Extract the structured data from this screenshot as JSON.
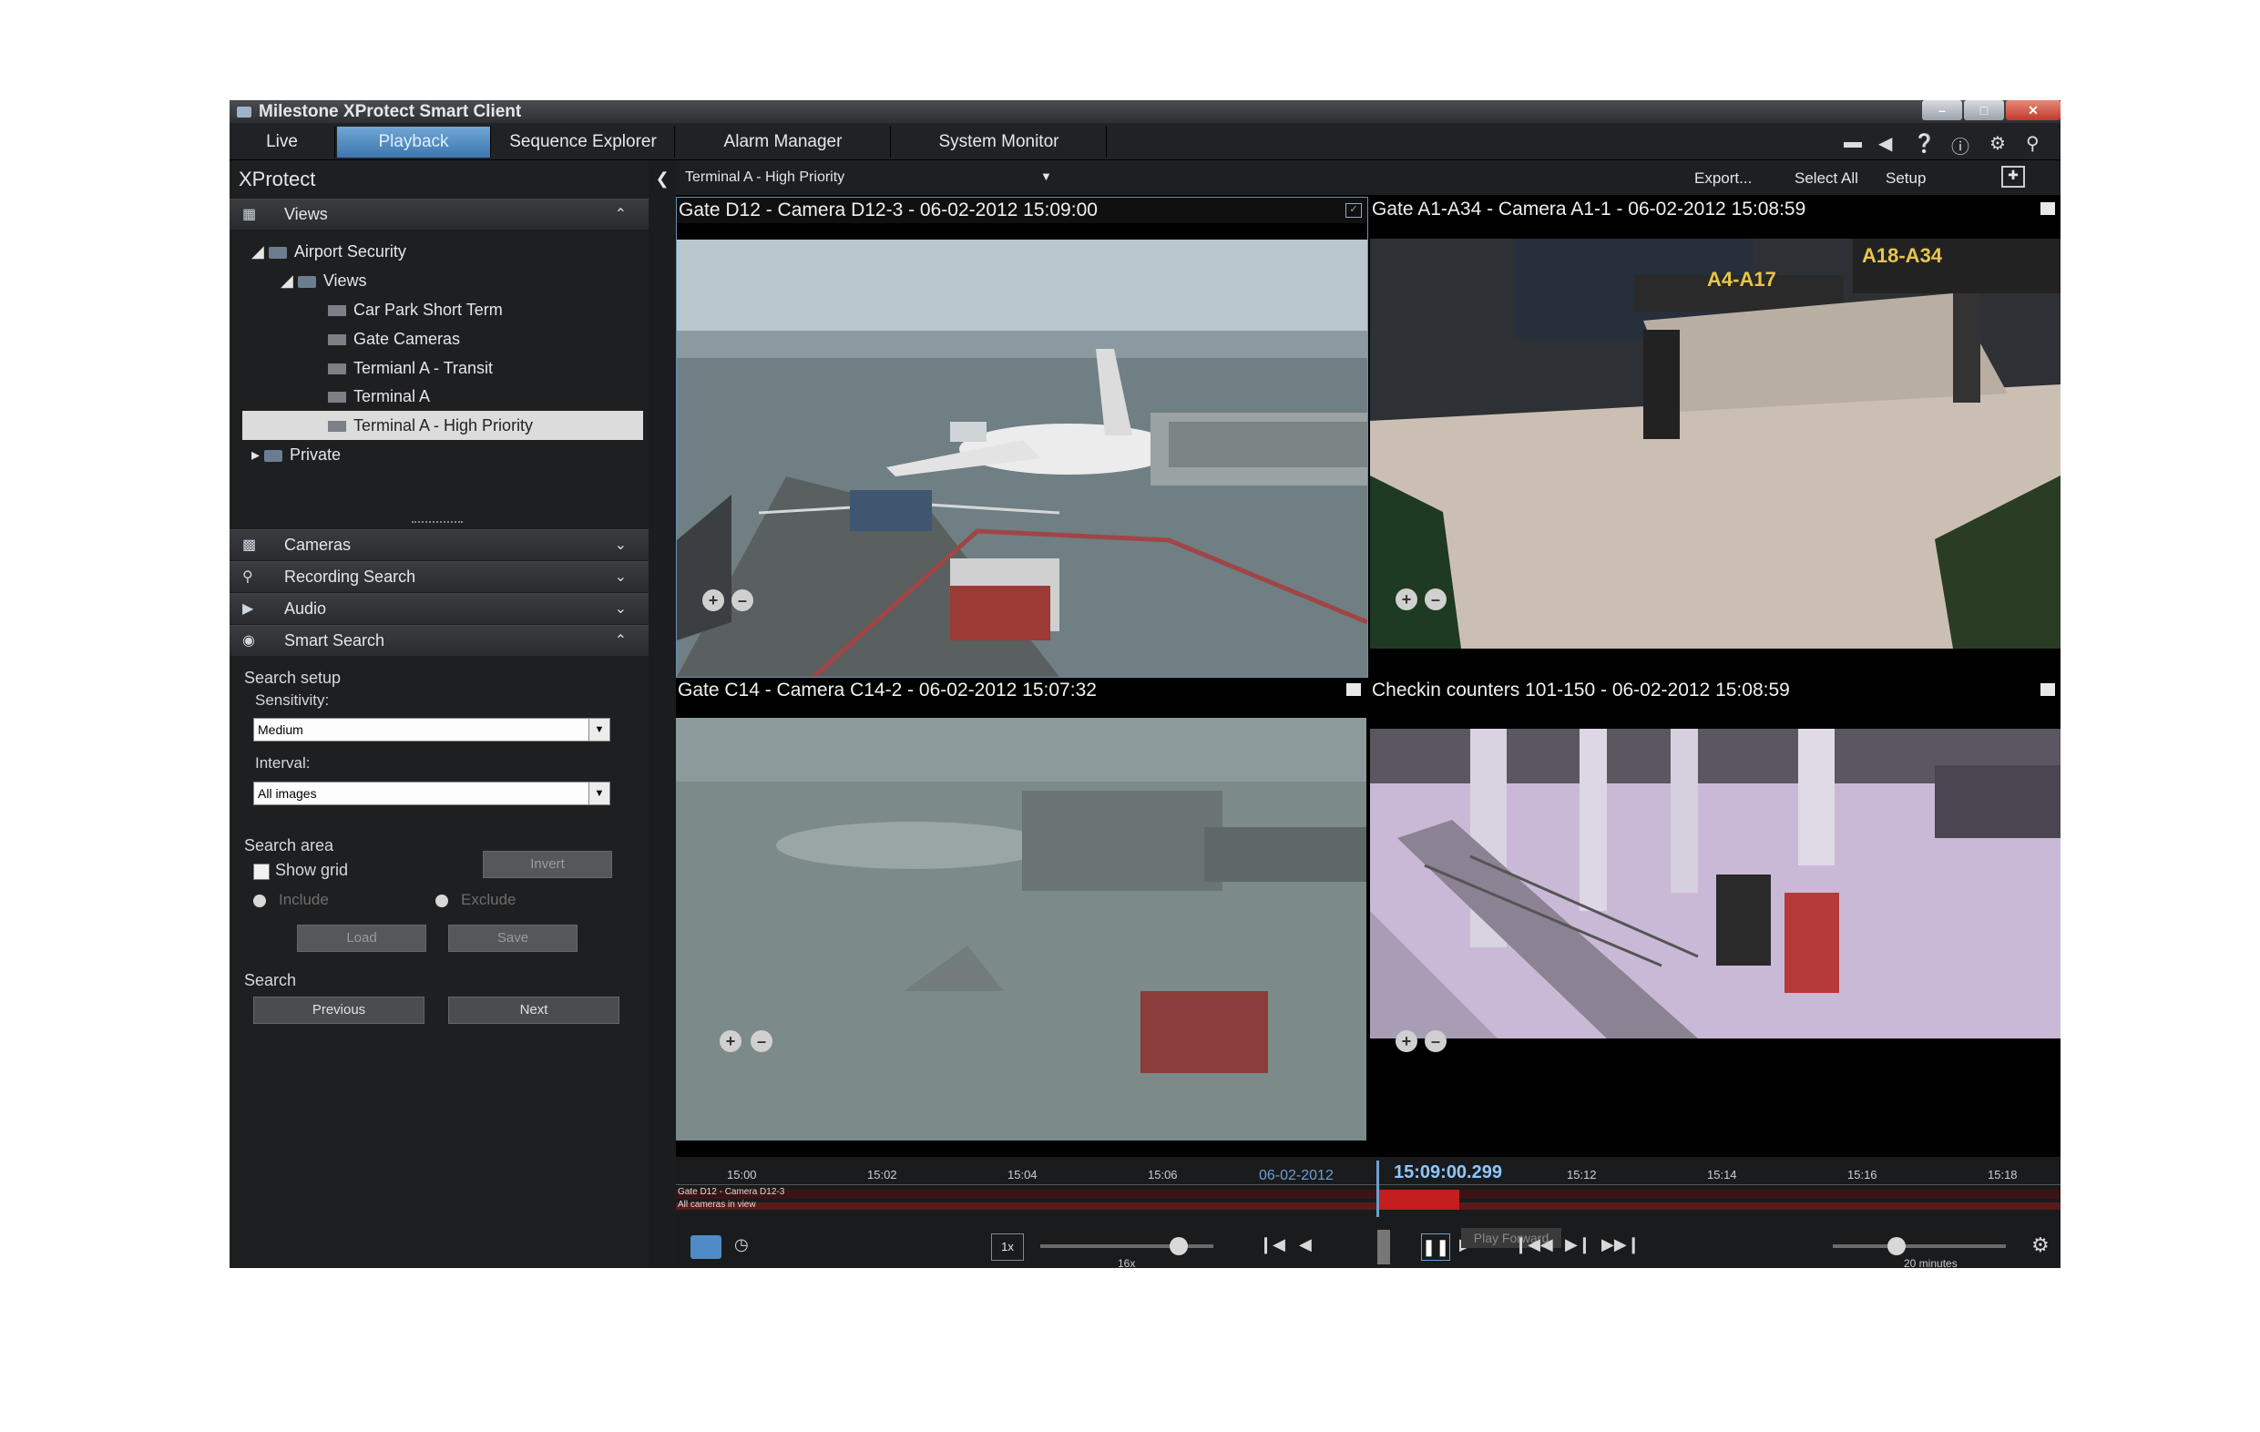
{
  "window": {
    "title": "Milestone XProtect Smart Client"
  },
  "tabs": [
    "Live",
    "Playback",
    "Sequence Explorer",
    "Alarm Manager",
    "System Monitor"
  ],
  "active_tab": "Playback",
  "left": {
    "title": "XProtect",
    "views_header": "Views",
    "tree": {
      "root": "Airport Security",
      "views_folder": "Views",
      "items": [
        "Car Park Short Term",
        "Gate Cameras",
        "Termianl A - Transit",
        "Terminal A",
        "Terminal A - High Priority"
      ],
      "private": "Private"
    },
    "sections": [
      "Cameras",
      "Recording Search",
      "Audio",
      "Smart Search"
    ],
    "smart_search": {
      "setup_label": "Search setup",
      "sensitivity_label": "Sensitivity:",
      "sensitivity_value": "Medium",
      "interval_label": "Interval:",
      "interval_value": "All images",
      "area_label": "Search area",
      "show_grid": "Show grid",
      "invert": "Invert",
      "include": "Include",
      "exclude": "Exclude",
      "load": "Load",
      "save": "Save",
      "search_label": "Search",
      "previous": "Previous",
      "next": "Next"
    }
  },
  "toolbar": {
    "view_name": "Terminal A - High Priority",
    "export": "Export...",
    "select_all": "Select All",
    "setup": "Setup"
  },
  "tiles": [
    {
      "caption": "Gate D12 - Camera D12-3 - 06-02-2012 15:09:00"
    },
    {
      "caption": "Gate A1-A34 - Camera A1-1 - 06-02-2012 15:08:59",
      "sign1": "A18-A34",
      "sign2": "A4-A17"
    },
    {
      "caption": "Gate C14 - Camera C14-2 - 06-02-2012 15:07:32"
    },
    {
      "caption": "Checkin counters 101-150 - 06-02-2012 15:08:59"
    }
  ],
  "timeline": {
    "ticks": [
      "15:00",
      "15:02",
      "15:04",
      "15:06",
      "15:12",
      "15:14",
      "15:16",
      "15:18"
    ],
    "date": "06-02-2012",
    "current_time": "15:09:00.299",
    "track1": "Gate D12 - Camera D12-3",
    "track2": "All cameras in view",
    "speed": "1x",
    "speed_max": "16x",
    "tooltip": "Play Forward",
    "span": "20 minutes"
  }
}
